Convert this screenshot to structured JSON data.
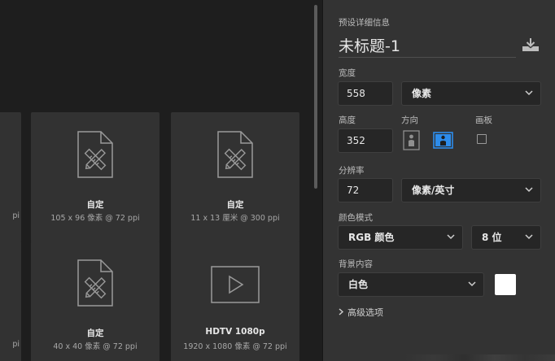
{
  "presets": [
    {
      "name": "",
      "sub": "pi"
    },
    {
      "name": "自定",
      "sub": "105 x 96 像素 @ 72 ppi"
    },
    {
      "name": "自定",
      "sub": "11 x 13 厘米 @ 300 ppi"
    },
    {
      "name": "",
      "sub": "pi"
    },
    {
      "name": "自定",
      "sub": "40 x 40 像素 @ 72 ppi"
    },
    {
      "name": "HDTV 1080p",
      "sub": "1920 x 1080 像素 @ 72 ppi"
    }
  ],
  "panel": {
    "section_title": "预设详细信息",
    "doc_title": "未标题-1",
    "width_label": "宽度",
    "width_value": "558",
    "width_unit": "像素",
    "height_label": "高度",
    "height_value": "352",
    "orientation_label": "方向",
    "artboard_label": "画板",
    "resolution_label": "分辨率",
    "resolution_value": "72",
    "resolution_unit": "像素/英寸",
    "color_mode_label": "颜色模式",
    "color_mode": "RGB 颜色",
    "bit_depth": "8 位",
    "background_label": "背景内容",
    "background": "白色",
    "background_color": "#ffffff",
    "advanced_label": "高级选项"
  },
  "colors": {
    "accent": "#2d8ceb",
    "panel_bg": "#333333",
    "canvas_bg": "#1e1e1e",
    "tile_bg": "#323232"
  },
  "icons": [
    "custom-doc-icon",
    "video-icon",
    "save-preset-icon",
    "chevron-down-icon",
    "portrait-icon",
    "landscape-icon",
    "chevron-right-icon"
  ]
}
